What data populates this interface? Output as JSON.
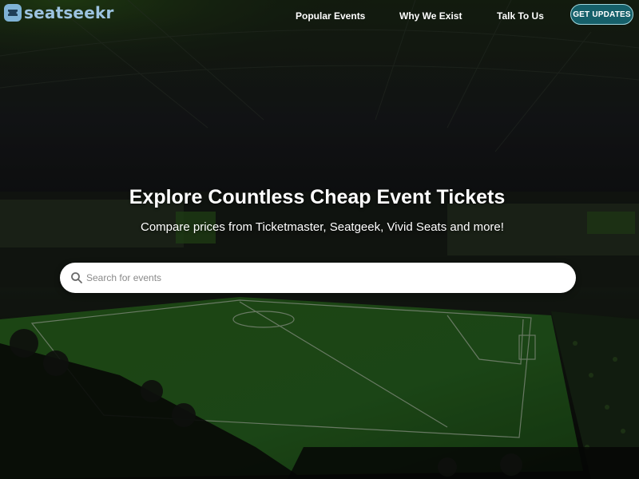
{
  "brand": {
    "name": "seatseekr",
    "logo_icon": "ticket-icon",
    "color": "#9cc3e0"
  },
  "nav": {
    "items": [
      {
        "label": "Popular Events"
      },
      {
        "label": "Why We Exist"
      },
      {
        "label": "Talk To Us"
      }
    ],
    "cta_label": "GET UPDATES",
    "cta_color": "#16606a"
  },
  "hero": {
    "title": "Explore Countless Cheap Event Tickets",
    "subtitle": "Compare prices from Ticketmaster, Seatgeek, Vivid Seats and more!"
  },
  "search": {
    "placeholder": "Search for events",
    "value": "",
    "icon": "search-icon"
  },
  "colors": {
    "pitch": "#2f6b22",
    "background": "#0c0f0b"
  }
}
